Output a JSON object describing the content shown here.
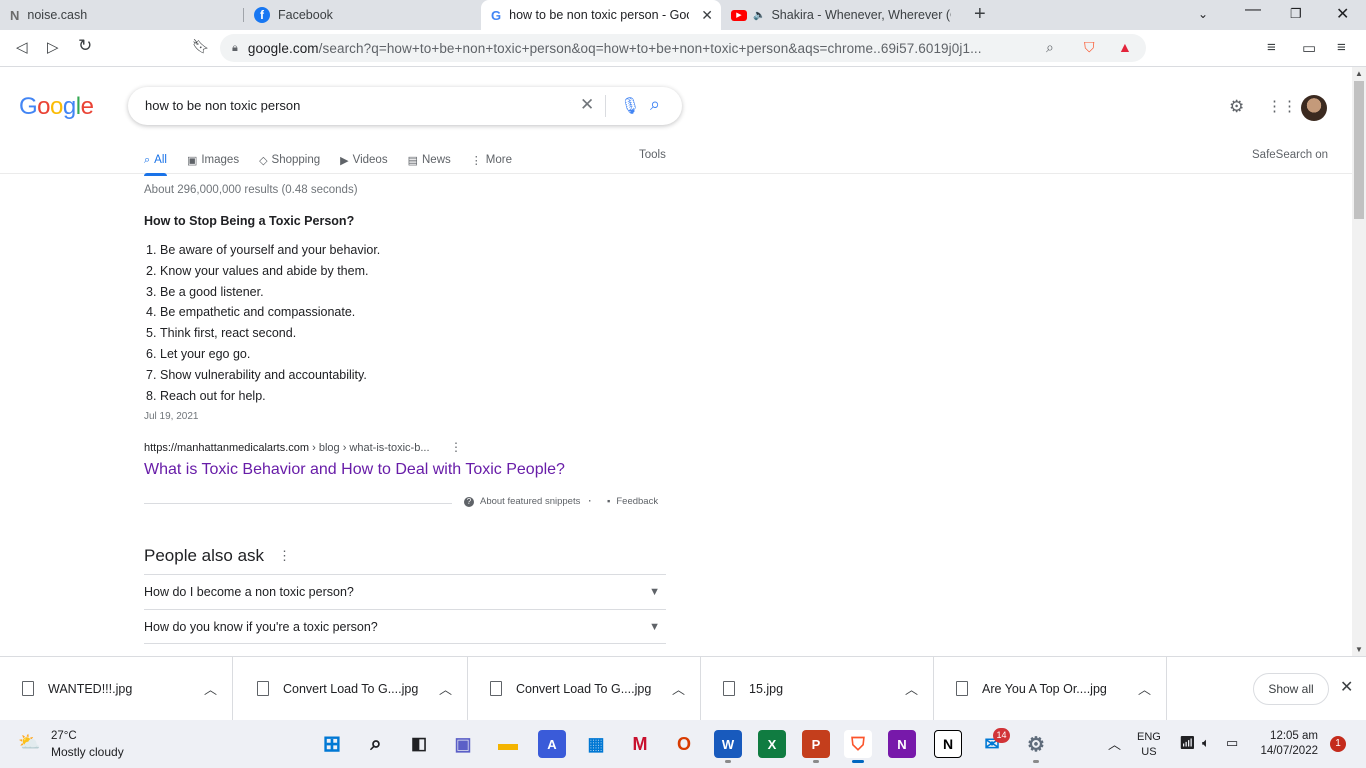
{
  "browser": {
    "tabs": [
      {
        "title": "noise.cash",
        "icon": "N",
        "active": false
      },
      {
        "title": "Facebook",
        "icon": "f",
        "active": false
      },
      {
        "title": "how to be non toxic person - Goo",
        "icon": "G",
        "active": true
      },
      {
        "title": "Shakira - Whenever, Wherever (Of",
        "icon": "yt",
        "active": false
      }
    ],
    "url_host": "google.com",
    "url_rest": "/search?q=how+to+be+non+toxic+person&oq=how+to+be+non+toxic+person&aqs=chrome..69i57.6019j0j1..."
  },
  "google": {
    "logo_text": "Google",
    "query": "how to be non toxic person",
    "nav_tabs": [
      {
        "label": "All",
        "icon": "🔍",
        "active": true
      },
      {
        "label": "Images",
        "icon": "🖼",
        "active": false
      },
      {
        "label": "Shopping",
        "icon": "◇",
        "active": false
      },
      {
        "label": "Videos",
        "icon": "▶",
        "active": false
      },
      {
        "label": "News",
        "icon": "▤",
        "active": false
      },
      {
        "label": "More",
        "icon": "⋮",
        "active": false
      }
    ],
    "tools": "Tools",
    "safesearch": "SafeSearch on",
    "stats": "About 296,000,000 results (0.48 seconds)",
    "snippet": {
      "title": "How to Stop Being a Toxic Person?",
      "items": [
        "Be aware of yourself and your behavior.",
        "Know your values and abide by them.",
        "Be a good listener.",
        "Be empathetic and compassionate.",
        "Think first, react second.",
        "Let your ego go.",
        "Show vulnerability and accountability.",
        "Reach out for help."
      ],
      "date": "Jul 19, 2021",
      "cite_host": "https://manhattanmedicalarts.com",
      "cite_path": " › blog › what-is-toxic-b...",
      "link": "What is Toxic Behavior and How to Deal with Toxic People?",
      "about": "About featured snippets",
      "feedback": "Feedback"
    },
    "paa": {
      "title": "People also ask",
      "questions": [
        "How do I become a non toxic person?",
        "How do you know if you're a toxic person?"
      ]
    }
  },
  "downloads": {
    "items": [
      "WANTED!!!.jpg",
      "Convert Load To G....jpg",
      "Convert Load To G....jpg",
      "15.jpg",
      "Are You A Top Or....jpg"
    ],
    "show_all": "Show all"
  },
  "taskbar": {
    "temp": "27°C",
    "weather": "Mostly cloudy",
    "badge": "14",
    "lang1": "ENG",
    "lang2": "US",
    "time": "12:05 am",
    "date": "14/07/2022",
    "notifications": "1"
  }
}
